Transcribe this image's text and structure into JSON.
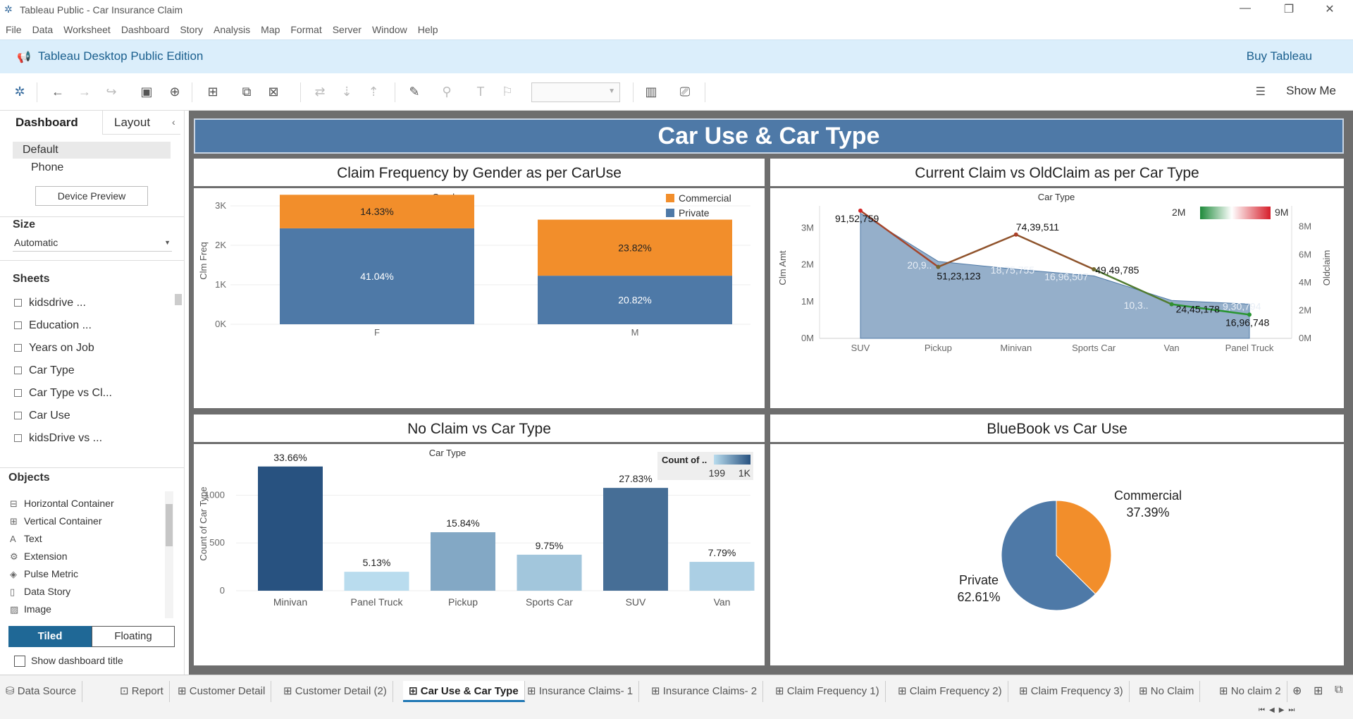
{
  "window": {
    "title": "Tableau Public - Car Insurance Claim"
  },
  "menu": [
    "File",
    "Data",
    "Worksheet",
    "Dashboard",
    "Story",
    "Analysis",
    "Map",
    "Format",
    "Server",
    "Window",
    "Help"
  ],
  "banner": {
    "edition": "Tableau Desktop Public Edition",
    "buy": "Buy Tableau"
  },
  "toolbar": {
    "show_me": "Show Me"
  },
  "leftpanel": {
    "tab_dashboard": "Dashboard",
    "tab_layout": "Layout",
    "device_default": "Default",
    "device_phone": "Phone",
    "device_preview": "Device Preview",
    "size_label": "Size",
    "size_value": "Automatic",
    "sheets_label": "Sheets",
    "sheets": [
      "kidsdrive ...",
      "Education ...",
      "Years on Job",
      "Car Type",
      "Car Type vs Cl...",
      "Car Use",
      "kidsDrive vs ..."
    ],
    "objects_label": "Objects",
    "objects": [
      "Horizontal Container",
      "Vertical Container",
      "Text",
      "Extension",
      "Pulse Metric",
      "Data Story",
      "Image"
    ],
    "tiled": "Tiled",
    "floating": "Floating",
    "show_title": "Show dashboard title"
  },
  "dashboard": {
    "title": "Car Use & Car Type"
  },
  "chart_data": [
    {
      "type": "bar",
      "title": "Claim Frequency by Gender as per CarUse",
      "header": "Gender",
      "categories": [
        "F",
        "M"
      ],
      "ylabel": "Clm Freq",
      "yticks": [
        "0K",
        "1K",
        "2K",
        "3K"
      ],
      "ylim": [
        0,
        3000
      ],
      "legend": [
        "Commercial",
        "Private"
      ],
      "series": [
        {
          "name": "Private",
          "values": [
            2430,
            1230
          ],
          "labels": [
            "41.04%",
            "20.82%"
          ],
          "color": "#4e79a7"
        },
        {
          "name": "Commercial",
          "values": [
            850,
            1420
          ],
          "labels": [
            "14.33%",
            "23.82%"
          ],
          "color": "#f28e2b"
        }
      ]
    },
    {
      "type": "area",
      "title": "Current Claim vs OldClaim as per Car Type",
      "header": "Car Type",
      "categories": [
        "SUV",
        "Pickup",
        "Minivan",
        "Sports Car",
        "Van",
        "Panel Truck"
      ],
      "ylabel": "Clm Amt",
      "y2label": "Oldclaim",
      "yticks": [
        "0M",
        "1M",
        "2M",
        "3M"
      ],
      "y2ticks": [
        "0M",
        "2M",
        "4M",
        "6M",
        "8M"
      ],
      "legend_min": "2M",
      "legend_max": "9M",
      "series": [
        {
          "name": "Clm Amt",
          "values": [
            3400000,
            2090000,
            1875755,
            1696507,
            1030000,
            930794
          ],
          "labels": [
            "",
            "20,9..",
            "18,75,755",
            "16,96,507",
            "10,3..",
            "9,30,794"
          ]
        },
        {
          "name": "Oldclaim",
          "values": [
            9152759,
            5123123,
            7439511,
            4949785,
            2445178,
            1696748
          ],
          "labels": [
            "91,52,759",
            "51,23,123",
            "74,39,511",
            "49,49,785",
            "24,45,178",
            "16,96,748"
          ]
        }
      ]
    },
    {
      "type": "bar",
      "title": "No Claim vs Car Type",
      "header": "Car Type",
      "categories": [
        "Minivan",
        "Panel Truck",
        "Pickup",
        "Sports Car",
        "SUV",
        "Van"
      ],
      "ylabel": "Count of Car Type",
      "yticks": [
        "0",
        "500",
        "1000"
      ],
      "values": [
        1300,
        198,
        612,
        377,
        1076,
        302
      ],
      "labels": [
        "33.66%",
        "5.13%",
        "15.84%",
        "9.75%",
        "27.83%",
        "7.79%"
      ],
      "legend_title": "Count of ..",
      "legend_min": "199",
      "legend_max": "1K"
    },
    {
      "type": "pie",
      "title": "BlueBook vs Car Use",
      "categories": [
        "Commercial",
        "Private"
      ],
      "values": [
        37.39,
        62.61
      ],
      "labels": [
        "37.39%",
        "62.61%"
      ],
      "colors": [
        "#f28e2b",
        "#4e79a7"
      ]
    }
  ],
  "tabs": [
    "Data Source",
    "Report",
    "Customer Detail",
    "Customer Detail (2)",
    "Car Use & Car Type",
    "Insurance Claims- 1",
    "Insurance Claims- 2",
    "Claim Frequency 1)",
    "Claim Frequency 2)",
    "Claim Frequency 3)",
    "No Claim",
    "No claim 2"
  ]
}
